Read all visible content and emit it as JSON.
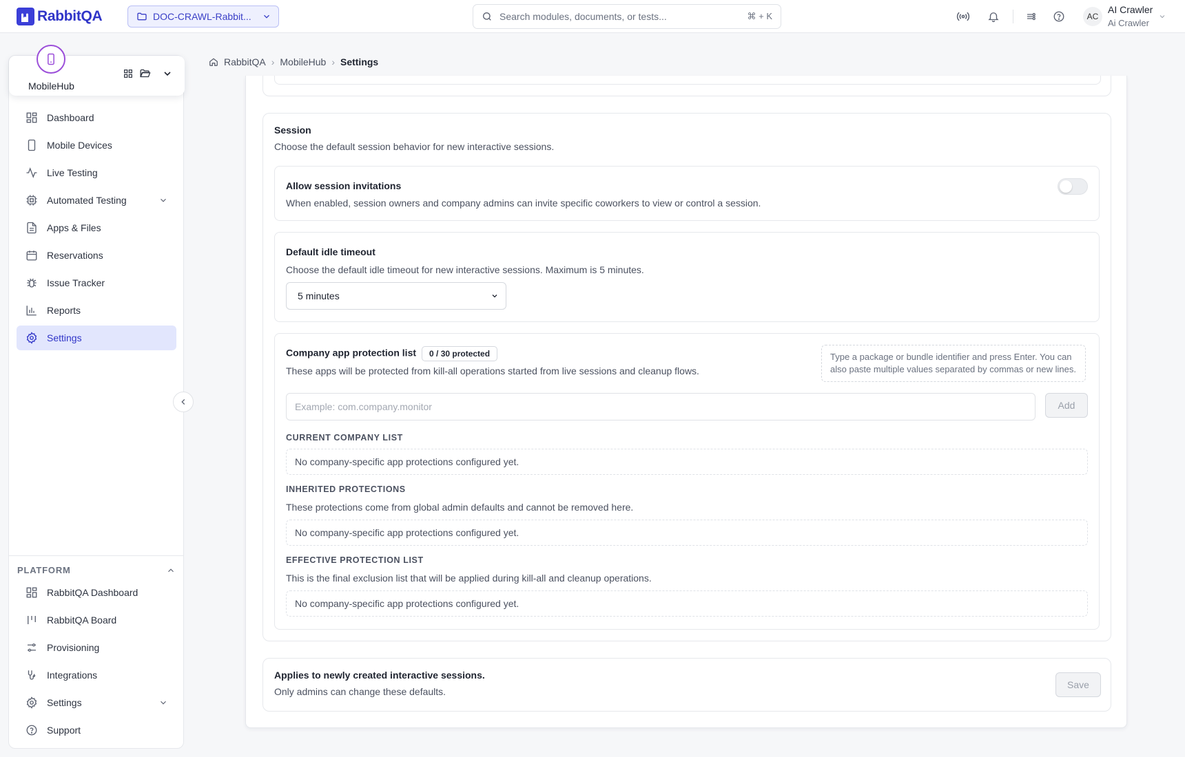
{
  "app": {
    "name": "RabbitQA"
  },
  "project": {
    "label": "DOC-CRAWL-Rabbit..."
  },
  "search": {
    "placeholder": "Search modules, documents, or tests...",
    "shortcut": "⌘ + K"
  },
  "user": {
    "initials": "AC",
    "name": "AI Crawler",
    "subtitle": "Ai Crawler"
  },
  "module": {
    "name": "MobileHub"
  },
  "nav": {
    "items": [
      {
        "label": "Dashboard",
        "icon": "grid-icon"
      },
      {
        "label": "Mobile Devices",
        "icon": "phone-icon"
      },
      {
        "label": "Live Testing",
        "icon": "activity-icon"
      },
      {
        "label": "Automated Testing",
        "icon": "cpu-icon"
      },
      {
        "label": "Apps & Files",
        "icon": "file-icon"
      },
      {
        "label": "Reservations",
        "icon": "calendar-icon"
      },
      {
        "label": "Issue Tracker",
        "icon": "bug-icon"
      },
      {
        "label": "Reports",
        "icon": "bar-chart-icon"
      },
      {
        "label": "Settings",
        "icon": "gear-icon"
      }
    ]
  },
  "platform": {
    "heading": "PLATFORM",
    "items": [
      {
        "label": "RabbitQA Dashboard",
        "icon": "grid-icon"
      },
      {
        "label": "RabbitQA Board",
        "icon": "kanban-icon"
      },
      {
        "label": "Provisioning",
        "icon": "sliders-icon"
      },
      {
        "label": "Integrations",
        "icon": "plug-icon"
      },
      {
        "label": "Settings",
        "icon": "gear-icon"
      },
      {
        "label": "Support",
        "icon": "help-circle-icon"
      }
    ]
  },
  "breadcrumb": {
    "root": "RabbitQA",
    "module": "MobileHub",
    "current": "Settings"
  },
  "session": {
    "title": "Session",
    "description": "Choose the default session behavior for new interactive sessions.",
    "invitations": {
      "title": "Allow session invitations",
      "description": "When enabled, session owners and company admins can invite specific coworkers to view or control a session.",
      "enabled": false
    },
    "idle": {
      "title": "Default idle timeout",
      "description": "Choose the default idle timeout for new interactive sessions. Maximum is 5 minutes.",
      "value": "5 minutes"
    },
    "protection": {
      "title": "Company app protection list",
      "badge": "0 / 30 protected",
      "description": "These apps will be protected from kill-all operations started from live sessions and cleanup flows.",
      "hint": "Type a package or bundle identifier and press Enter. You can also paste multiple values separated by commas or new lines.",
      "input_placeholder": "Example: com.company.monitor",
      "add_label": "Add",
      "current_heading": "CURRENT COMPANY LIST",
      "current_empty": "No company-specific app protections configured yet.",
      "inherited_heading": "INHERITED PROTECTIONS",
      "inherited_desc": "These protections come from global admin defaults and cannot be removed here.",
      "inherited_empty": "No company-specific app protections configured yet.",
      "effective_heading": "EFFECTIVE PROTECTION LIST",
      "effective_desc": "This is the final exclusion list that will be applied during kill-all and cleanup operations.",
      "effective_empty": "No company-specific app protections configured yet."
    }
  },
  "footer": {
    "title": "Applies to newly created interactive sessions.",
    "description": "Only admins can change these defaults.",
    "save_label": "Save"
  },
  "colors": {
    "accent": "#3035c8",
    "active_bg": "#e2e6fd",
    "module_ring": "#9b4ed9"
  }
}
